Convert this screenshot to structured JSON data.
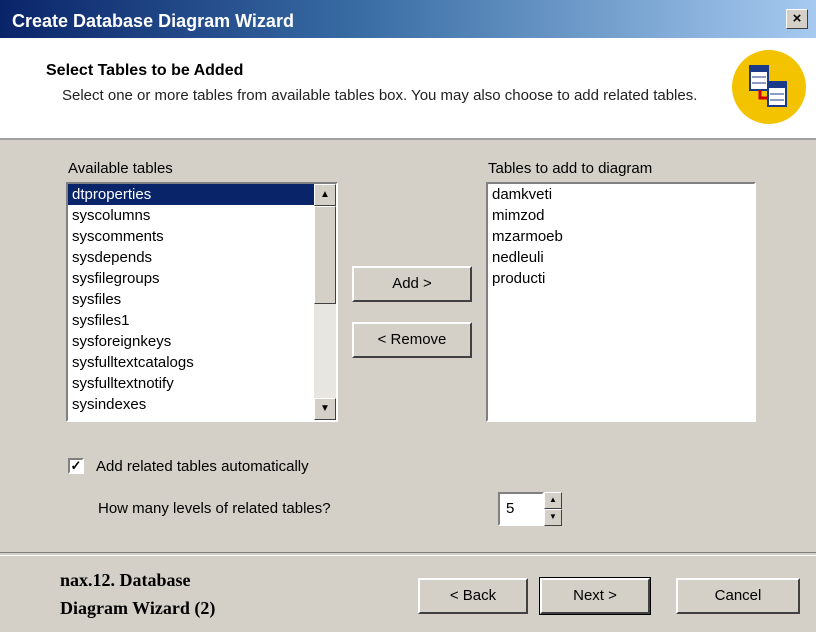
{
  "window": {
    "title": "Create Database Diagram Wizard",
    "close_label": "×"
  },
  "header": {
    "title": "Select Tables to be Added",
    "description": "Select one or more tables from available tables box. You may also choose to add related tables."
  },
  "available": {
    "label": "Available tables",
    "items": [
      "dtproperties",
      "syscolumns",
      "syscomments",
      "sysdepends",
      "sysfilegroups",
      "sysfiles",
      "sysfiles1",
      "sysforeignkeys",
      "sysfulltextcatalogs",
      "sysfulltextnotify",
      "sysindexes"
    ],
    "selected_index": 0
  },
  "added": {
    "label": "Tables to add to diagram",
    "items": [
      "damkveti",
      "mimzod",
      "mzarmoeb",
      "nedleuli",
      "producti"
    ]
  },
  "buttons": {
    "add": "Add >",
    "remove": "< Remove",
    "back": "< Back",
    "next": "Next >",
    "cancel": "Cancel"
  },
  "options": {
    "related_label": "Add related tables automatically",
    "related_checked": true,
    "levels_label": "How many levels of related tables?",
    "levels_value": "5"
  },
  "caption": {
    "line1_num": "nax.12.",
    "line1_text": "Database",
    "line2": "Diagram Wizard (2)"
  }
}
